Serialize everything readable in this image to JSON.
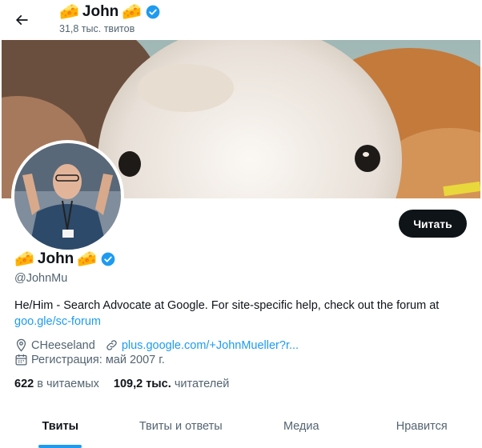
{
  "header": {
    "name": "John",
    "tweets_count": "31,8 тыс. твитов"
  },
  "profile": {
    "name": "John",
    "handle": "@JohnMu",
    "bio_text": "He/Him - Search Advocate at Google. For site-specific help, check out the forum at",
    "bio_link": "goo.gle/sc-forum",
    "location": "CHeeseland",
    "website": "plus.google.com/+JohnMueller?r...",
    "joined": "Регистрация: май 2007 г.",
    "following_count": "622",
    "following_label": "в читаемых",
    "followers_count": "109,2 тыс.",
    "followers_label": "читателей",
    "follow_button": "Читать",
    "emoji": "🧀"
  },
  "tabs": [
    {
      "label": "Твиты",
      "active": true
    },
    {
      "label": "Твиты и ответы",
      "active": false
    },
    {
      "label": "Медиа",
      "active": false
    },
    {
      "label": "Нравится",
      "active": false
    }
  ],
  "colors": {
    "accent": "#1d9bf0",
    "text": "#0f1419",
    "secondary": "#536471",
    "button_bg": "#0f1419"
  },
  "icons": {
    "back": "arrow-left-icon",
    "verified": "verified-badge-icon",
    "location": "location-pin-icon",
    "link": "link-icon",
    "calendar": "calendar-icon"
  }
}
